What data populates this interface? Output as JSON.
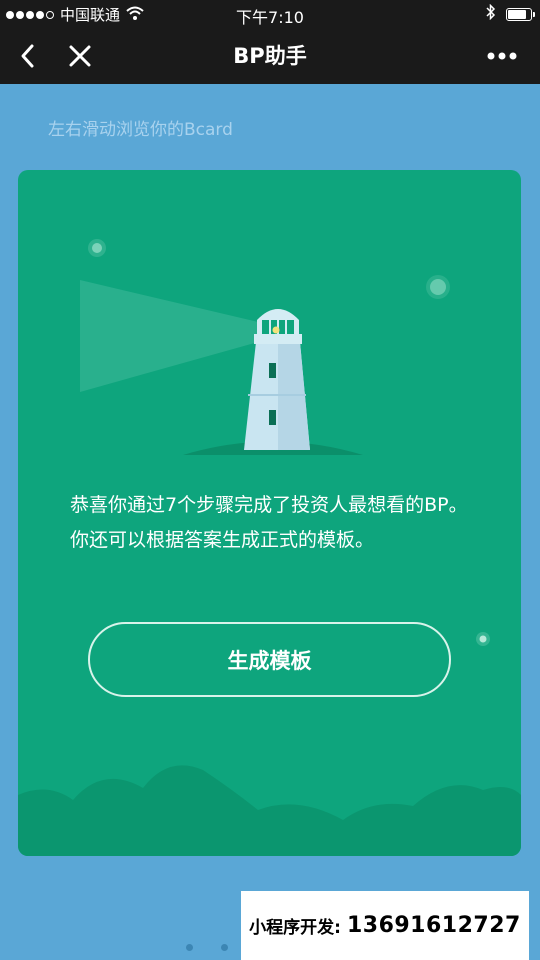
{
  "status_bar": {
    "carrier": "中国联通",
    "time": "下午7:10"
  },
  "nav": {
    "title": "BP助手"
  },
  "content": {
    "hint": "左右滑动浏览你的Bcard",
    "message": "恭喜你通过7个步骤完成了投资人最想看的BP。你还可以根据答案生成正式的模板。",
    "button_label": "生成模板"
  },
  "ad": {
    "label": "小程序开发:",
    "phone": "13691612727"
  },
  "colors": {
    "page_bg": "#5aa7d6",
    "card_bg": "#0ea57d",
    "nav_bg": "#1a1a1a"
  }
}
